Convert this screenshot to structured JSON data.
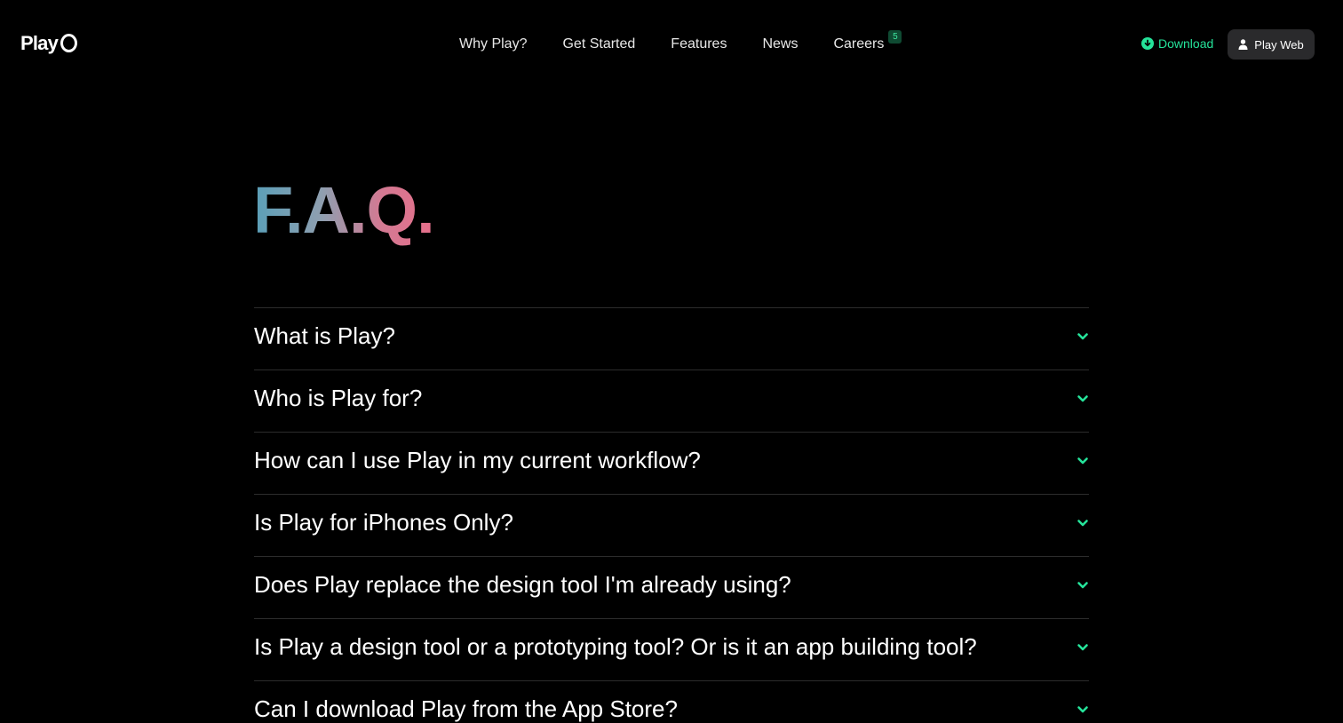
{
  "header": {
    "logo_text": "Play",
    "nav": [
      {
        "label": "Why Play?"
      },
      {
        "label": "Get Started"
      },
      {
        "label": "Features"
      },
      {
        "label": "News"
      },
      {
        "label": "Careers",
        "badge": "5"
      }
    ],
    "download_label": "Download",
    "play_web_label": "Play Web"
  },
  "faq": {
    "title": "F.A.Q.",
    "items": [
      {
        "question": "What is Play?"
      },
      {
        "question": "Who is Play for?"
      },
      {
        "question": "How can I use Play in my current workflow?"
      },
      {
        "question": "Is Play for iPhones Only?"
      },
      {
        "question": "Does Play replace the design tool I'm already using?"
      },
      {
        "question": "Is Play a design tool or a prototyping tool? Or is it an app building tool?"
      },
      {
        "question": "Can I download Play from the App Store?"
      }
    ]
  },
  "colors": {
    "background": "#000000",
    "accent": "#25e39a",
    "divider": "#2c2c2c",
    "button_bg": "#2a2a2c",
    "title_gradient": [
      "#5a9fb8",
      "#8f9fb0",
      "#d27a93",
      "#e76f8b"
    ]
  },
  "icons": {
    "download": "download-circle-icon",
    "user": "user-icon",
    "expand": "chevron-down-icon"
  }
}
